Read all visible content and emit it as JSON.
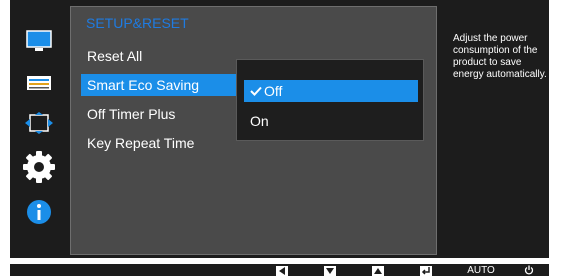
{
  "menu": {
    "title": "SETUP&RESET",
    "items": [
      {
        "label": "Reset All"
      },
      {
        "label": "Smart Eco Saving"
      },
      {
        "label": "Off Timer Plus"
      },
      {
        "label": "Key Repeat Time"
      }
    ],
    "selected_index": 1
  },
  "submenu": {
    "options": [
      {
        "label": "Off",
        "checked": true
      },
      {
        "label": "On",
        "checked": false
      }
    ],
    "selected_label": "Off"
  },
  "help_text": "Adjust the power consumption of the product to save energy automatically.",
  "side_icons": [
    "picture-icon",
    "color-icon",
    "size-position-icon",
    "setup-reset-gear-icon",
    "information-icon"
  ],
  "bottom_keys": {
    "left": "left-arrow-key-icon",
    "down": "down-arrow-key-icon",
    "up": "up-arrow-key-icon",
    "enter": "enter-key-icon",
    "auto_label": "AUTO",
    "power": "power-icon"
  },
  "colors": {
    "osd_background": "#1c1c1c",
    "panel_background": "#4a4a4a",
    "accent_blue": "#1b8ee8",
    "title_blue": "#1f7be0",
    "text": "#ffffff"
  }
}
